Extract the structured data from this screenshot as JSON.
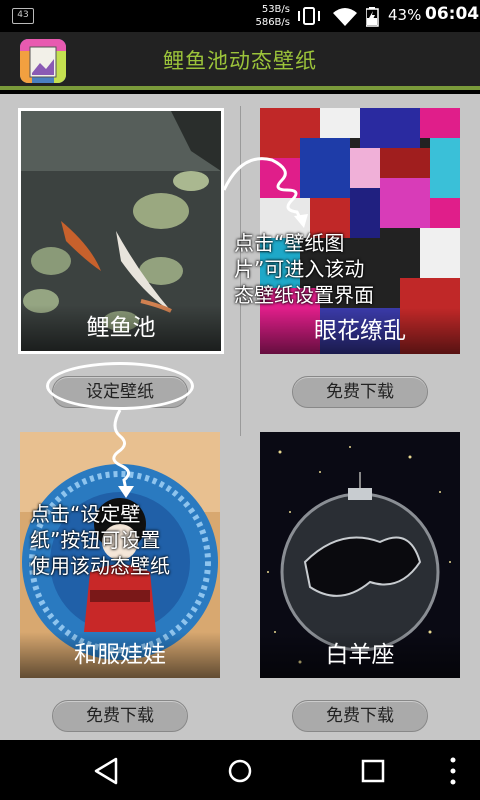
{
  "status_bar": {
    "notification_count": "43",
    "speed_up": "53B/s",
    "speed_down": "586B/s",
    "battery": "43%",
    "time": "06:04",
    "icons": [
      "vibrate-icon",
      "wifi-icon",
      "battery-icon"
    ]
  },
  "header": {
    "title": "鲤鱼池动态壁纸"
  },
  "wallpapers": [
    {
      "name": "鲤鱼池",
      "button": "设定壁纸",
      "selected": true
    },
    {
      "name": "眼花缭乱",
      "button": "免费下载",
      "selected": false
    },
    {
      "name": "和服娃娃",
      "button": "免费下载",
      "selected": false
    },
    {
      "name": "白羊座",
      "button": "免费下载",
      "selected": false
    }
  ],
  "hints": {
    "tap_image": "点击“壁纸图\n片”可进入该动\n态壁纸设置界面",
    "tap_button": "点击“设定壁\n纸”按钮可设置\n使用该动态壁纸"
  },
  "colors": {
    "accent_green": "#9bc33a",
    "header_line": "#7a9a3a",
    "background": "#c6c6c6"
  }
}
